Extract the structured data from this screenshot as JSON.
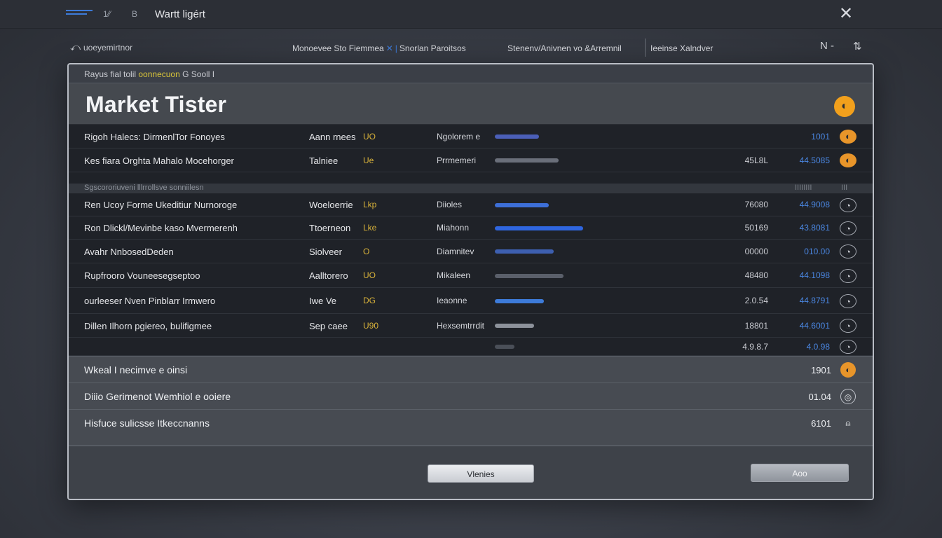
{
  "titlebar": {
    "nav_a": "1⁄⁄",
    "nav_b": "B",
    "title": "Wartt ligért",
    "close_glyph": "✕"
  },
  "toolbar": {
    "back_label": "uoeyemirtnor",
    "crumb_a": "Monoevee Sto Fiemmea",
    "crumb_b": "Snorlan Paroitsos",
    "filter_a": "Stenenv/Anivnen vo &Arremnil",
    "filter_b": "Ieeinse Xalndver",
    "tool_a": "N -",
    "tool_b": "⇅"
  },
  "panel": {
    "crumb_pre": "Rayus fial tolil",
    "crumb_hl": "oonnecuon",
    "crumb_post": "G Sooll I",
    "title": "Market Tister",
    "header_badge": "◐"
  },
  "table": {
    "ghost_row": {
      "label": "Sgscororiuveni lllrrollsve sonniilesn",
      "v1": "IIIIIIII",
      "v2": "III"
    },
    "rows": [
      {
        "name": "Rigoh Halecs: DirmenlTor Fonoyes",
        "type": "Aann rnees",
        "flag": "UO",
        "tag": "Ngolorem e",
        "value": "",
        "change": "1001",
        "icon": "orange",
        "spark_color": "#4b5fb8",
        "spark_width": 0.45
      },
      {
        "name": "Kes fiara Orghta Mahalo Mocehorger",
        "type": "Talniee",
        "flag": "Ue",
        "tag": "Prrmemeri",
        "value": "45L8L",
        "change": "44.5085",
        "icon": "orange",
        "spark_color": "#6a6f7a",
        "spark_width": 0.65
      },
      {
        "name": "Ren Ucoy Forme Ukeditiur Nurnoroge",
        "type": "Woeloerrie",
        "flag": "Lkp",
        "tag": "Diioles",
        "value": "76080",
        "change": "44.9008",
        "icon": "line",
        "spark_color": "#3d6fd8",
        "spark_width": 0.55
      },
      {
        "name": "Ron Dlickl/Mevinbe kaso Mvermerenh",
        "type": "Ttoerneon",
        "flag": "Lke",
        "tag": "Miahonn",
        "value": "50169",
        "change": "43.8081",
        "icon": "line",
        "spark_color": "#2f66e0",
        "spark_width": 0.9
      },
      {
        "name": "Avahr NnbosedDeden",
        "type": "Siolveer",
        "flag": "O",
        "tag": "Diamnitev",
        "value": "00000",
        "change": "010.00",
        "icon": "line",
        "spark_color": "#3d5fb0",
        "spark_width": 0.6
      },
      {
        "name": "Rupfrooro Vouneesegseptoo",
        "type": "Aalltorero",
        "flag": "UO",
        "tag": "Mikaleen",
        "value": "48480",
        "change": "44.1098",
        "icon": "line",
        "spark_color": "#5a5f6a",
        "spark_width": 0.7
      },
      {
        "name": "ourleeser Nven Pinblarr Irmwero",
        "type": "Iwe Ve",
        "flag": "DG",
        "tag": "Ieaonne",
        "value": "2.0.54",
        "change": "44.8791",
        "icon": "line",
        "spark_color": "#3d7bd9",
        "spark_width": 0.5
      },
      {
        "name": "Dillen Ilhorn pgiereo, bulifigmee",
        "type": "Sep caee",
        "flag": "U90",
        "tag": "Hexsemtrrdit",
        "value": "18801",
        "change": "44.6001",
        "icon": "line",
        "spark_color": "#8d929b",
        "spark_width": 0.4
      },
      {
        "name": "",
        "type": "",
        "flag": "",
        "tag": "",
        "value": "4.9.8.7",
        "change": "4.0.98",
        "icon": "line",
        "spark_color": "#4a4f58",
        "spark_width": 0.2
      }
    ]
  },
  "summary": [
    {
      "label": "Wkeal I necimve e oinsi",
      "value": "1901",
      "icon": "orange"
    },
    {
      "label": "Diiio Gerimenot Wemhiol e ooiere",
      "value": "01.04",
      "icon": "line"
    },
    {
      "label": "Hisfuce sulicsse Itkeccnanns",
      "value": "6101",
      "icon": "plain"
    }
  ],
  "footer": {
    "primary_label": "Vlenies",
    "secondary_label": "Aoo"
  }
}
